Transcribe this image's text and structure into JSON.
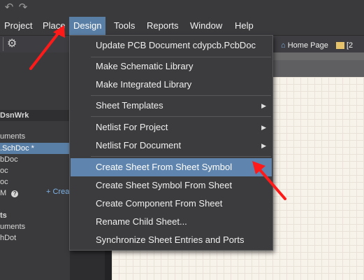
{
  "colors": {
    "menu_active": "#5a7fa6",
    "dropdown_highlight": "#5f84ad",
    "arrow": "#ff1a1a"
  },
  "menubar": {
    "items": [
      "Project",
      "Place",
      "Design",
      "Tools",
      "Reports",
      "Window",
      "Help"
    ],
    "active": "Design"
  },
  "design_menu": {
    "items": [
      {
        "label": "Update PCB Document cdypcb.PcbDoc",
        "submenu": false
      },
      {
        "label": "Make Schematic Library",
        "submenu": false
      },
      {
        "label": "Make Integrated Library",
        "submenu": false
      },
      {
        "label": "Sheet Templates",
        "submenu": true
      },
      {
        "label": "Netlist For Project",
        "submenu": true
      },
      {
        "label": "Netlist For Document",
        "submenu": true
      },
      {
        "label": "Create Sheet From Sheet Symbol",
        "submenu": false,
        "highlighted": true
      },
      {
        "label": "Create Sheet Symbol From Sheet",
        "submenu": false
      },
      {
        "label": "Create Component From Sheet",
        "submenu": false
      },
      {
        "label": "Rename Child Sheet...",
        "submenu": false
      },
      {
        "label": "Synchronize Sheet Entries and Ports",
        "submenu": false
      }
    ],
    "submenu_glyph": "▶"
  },
  "tabs": {
    "home_page": "Home Page",
    "extra": "[2"
  },
  "left_panel": {
    "rows": [
      {
        "text": "DsnWrk",
        "bold": true
      },
      {
        "text": "uments",
        "bold": false
      },
      {
        "text": ".SchDoc *",
        "bold": false,
        "selected": true
      },
      {
        "text": "bDoc",
        "bold": false
      },
      {
        "text": "oc",
        "bold": false
      },
      {
        "text": "oc",
        "bold": false
      },
      {
        "text": "M",
        "bold": false
      },
      {
        "text": "ts",
        "bold": true
      },
      {
        "text": "uments",
        "bold": false
      },
      {
        "text": "hDot",
        "bold": false
      }
    ],
    "create_link": "+ Crea"
  },
  "icons": {
    "undo": "undo-icon",
    "redo": "redo-icon",
    "gear": "gear-icon",
    "home": "home-icon",
    "help_circle": "help-icon"
  }
}
